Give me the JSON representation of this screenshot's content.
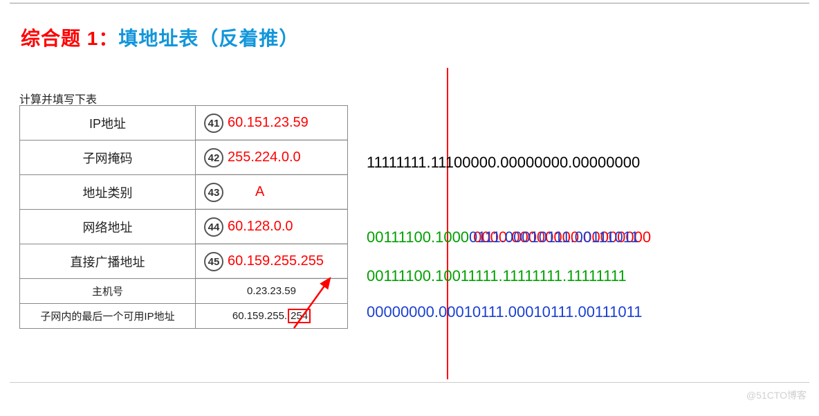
{
  "heading": {
    "prefix": "综合题 1：",
    "main": "填地址表（反着推）"
  },
  "table_caption": "计算并填写下表",
  "rows": {
    "ip": {
      "label": "IP地址",
      "num": "41",
      "answer": "60.151.23.59"
    },
    "mask": {
      "label": "子网掩码",
      "num": "42",
      "answer": "255.224.0.0"
    },
    "class": {
      "label": "地址类别",
      "num": "43",
      "answer": "A"
    },
    "net": {
      "label": "网络地址",
      "num": "44",
      "answer": "60.128.0.0"
    },
    "bcast": {
      "label": "直接广播地址",
      "num": "45",
      "answer": "60.159.255.255"
    },
    "host": {
      "label": "主机号",
      "value": "0.23.23.59"
    },
    "lastip": {
      "label": "子网内的最后一个可用IP地址",
      "value_prefix": "60.159.255.",
      "value_box": "254"
    }
  },
  "binary": {
    "mask": "11111111.11100000.00000000.00000000",
    "net_full": "00111100.10000000.00000000.00000000",
    "net_over": "00111100.10010111.00010111.00111011",
    "bcast": "00111100.10011111.11111111.11111111",
    "host": "00000000.00010111.00010111.00111011",
    "split_index": 12
  },
  "watermark": "@51CTO博客"
}
